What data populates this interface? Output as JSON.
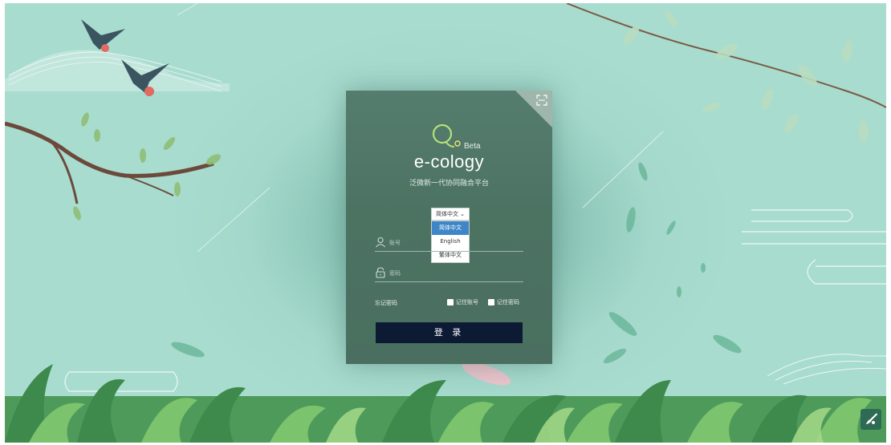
{
  "brand": {
    "name": "e-cology",
    "badge": "Beta",
    "subtitle": "泛微新一代协同融合平台"
  },
  "language": {
    "selected_label": "简体中文 ⌄",
    "options": [
      "简体中文",
      "English",
      "繁体中文"
    ],
    "selected_index": 0
  },
  "form": {
    "account_placeholder": "账号",
    "password_placeholder": "密码",
    "forgot_label": "忘记密码",
    "remember_account_label": "记住账号",
    "remember_password_label": "记住密码",
    "login_label": "登 录"
  },
  "icons": {
    "fullscreen": "scan-corners-icon",
    "user": "user-icon",
    "lock": "lock-icon",
    "theme": "paint-brush-icon"
  },
  "colors": {
    "card_bg": "#4c7262",
    "login_button": "#0d1a33",
    "selected_option": "#3f86c8",
    "background": "#a8dccf"
  }
}
